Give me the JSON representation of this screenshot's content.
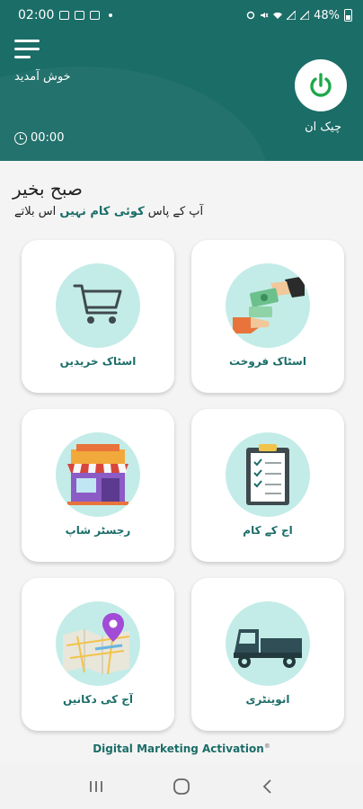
{
  "status_bar": {
    "time": "02:00",
    "battery": "48%"
  },
  "header": {
    "welcome": "خوش آمدید",
    "timer": "00:00",
    "checkin_label": "چیک ان"
  },
  "greeting": {
    "title": "صبح بخیر",
    "notice_pre": "آپ کے پاس ",
    "notice_highlight": "کوئی کام نہیں",
    "notice_post": " اس بلاتے"
  },
  "cards": [
    {
      "label": "اسٹاک خریدیں",
      "icon": "shopping-cart-icon"
    },
    {
      "label": "اسٹاک فروخت",
      "icon": "money-exchange-icon"
    },
    {
      "label": "رجسٹر شاپ",
      "icon": "shop-icon"
    },
    {
      "label": "اج کے کام",
      "icon": "clipboard-icon"
    },
    {
      "label": "آج کی دکانیں",
      "icon": "map-pin-icon"
    },
    {
      "label": "انوینٹری",
      "icon": "delivery-vehicle-icon"
    }
  ],
  "footer": {
    "brand": "Digital Marketing Activation",
    "mark": "®"
  },
  "colors": {
    "primary": "#1b6d68",
    "accent_green": "#1fa84b",
    "circle": "#c3ece8"
  }
}
